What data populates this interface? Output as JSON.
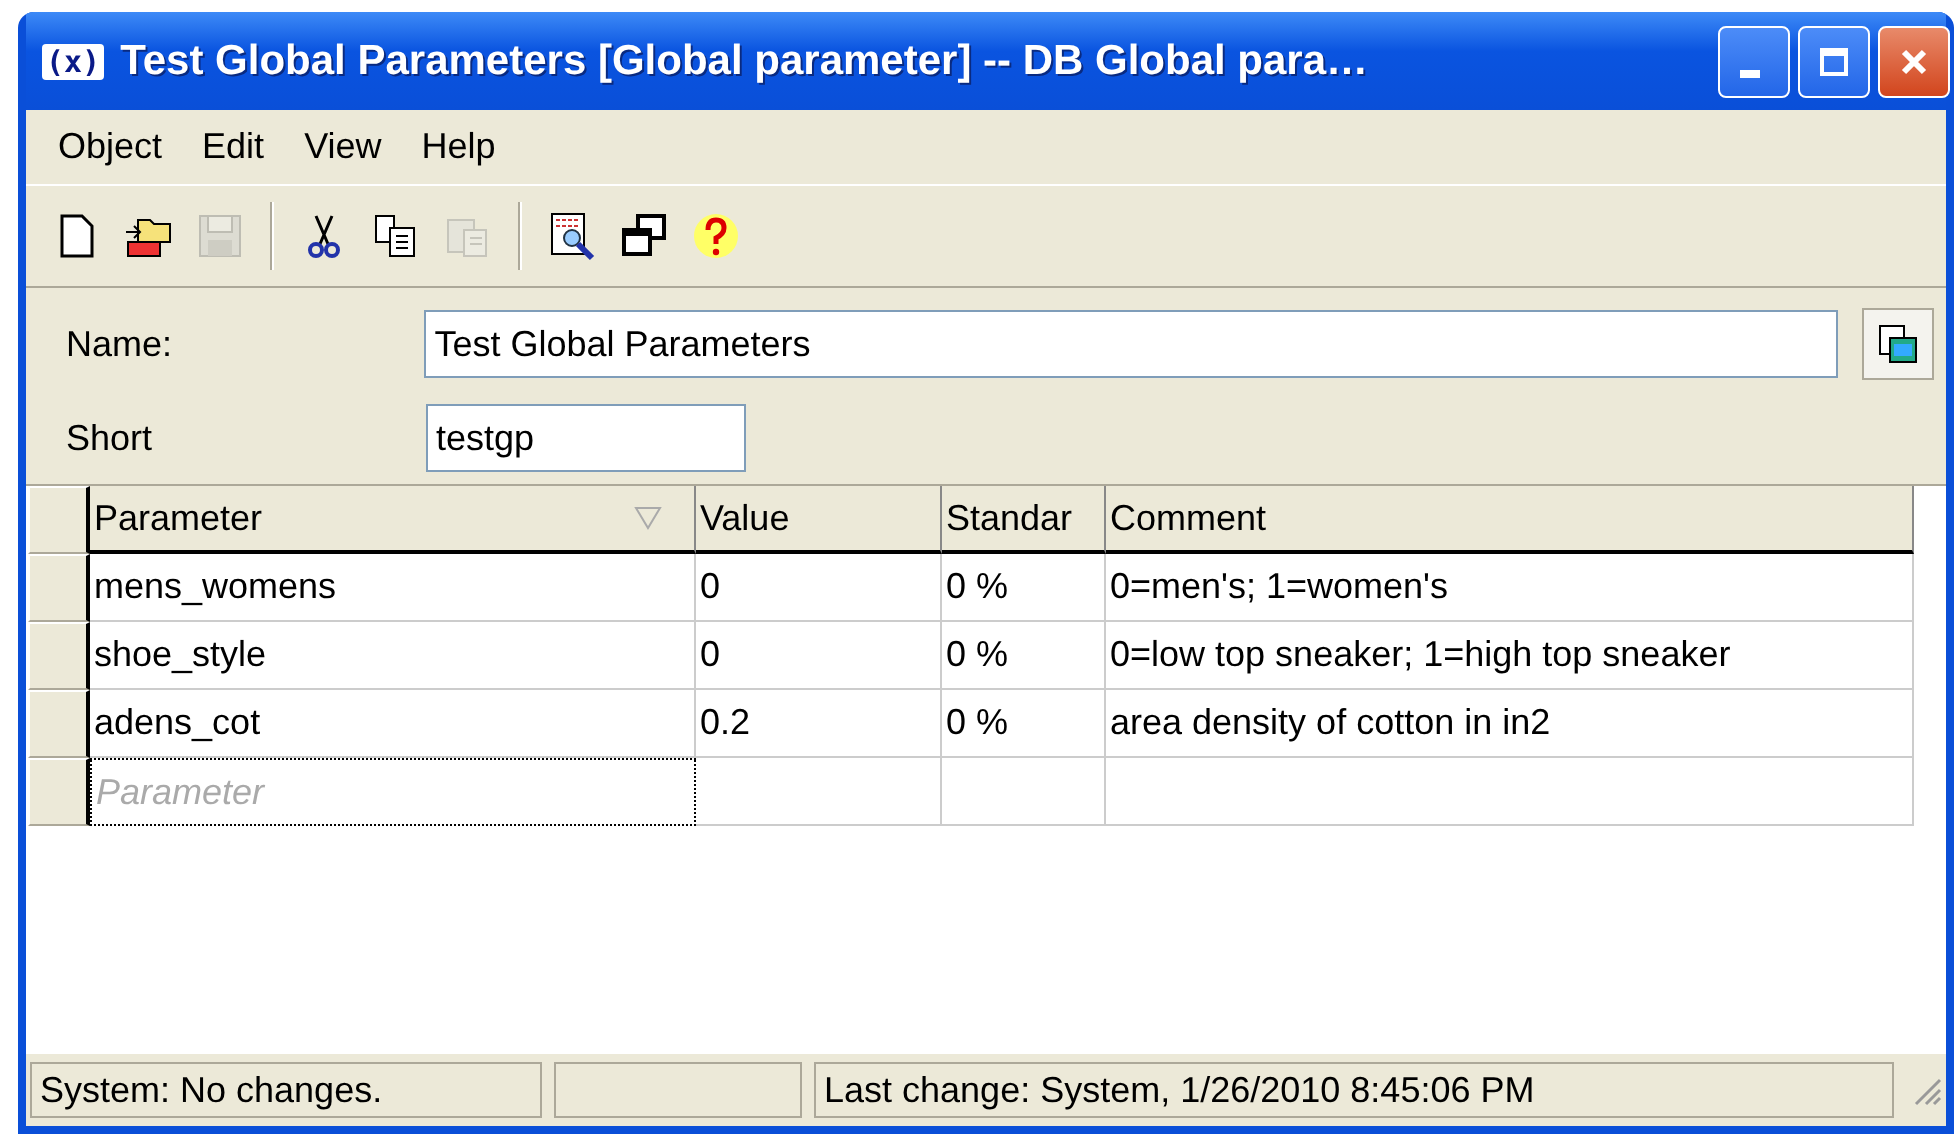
{
  "window": {
    "icon": "(x)",
    "title": "Test Global Parameters [Global parameter] -- DB Global para…"
  },
  "menu": [
    "Object",
    "Edit",
    "View",
    "Help"
  ],
  "toolbar": [
    [
      {
        "kind": "new",
        "disabled": false
      },
      {
        "kind": "open",
        "disabled": false
      },
      {
        "kind": "save",
        "disabled": true
      }
    ],
    [
      {
        "kind": "cut",
        "disabled": false
      },
      {
        "kind": "copy",
        "disabled": false
      },
      {
        "kind": "paste",
        "disabled": true
      }
    ],
    [
      {
        "kind": "preview",
        "disabled": false
      },
      {
        "kind": "windows",
        "disabled": false
      },
      {
        "kind": "help",
        "disabled": false
      }
    ]
  ],
  "form": {
    "name_label": "Name:",
    "name_value": "Test Global Parameters",
    "short_label": "Short",
    "short_value": "testgp"
  },
  "table": {
    "columns": [
      "Parameter",
      "Value",
      "Standar",
      "Comment"
    ],
    "rows": [
      [
        "mens_womens",
        "0",
        "0 %",
        "0=men's; 1=women's"
      ],
      [
        "shoe_style",
        "0",
        "0 %",
        "0=low top sneaker; 1=high top sneaker"
      ],
      [
        "adens_cot",
        "0.2",
        "0 %",
        "area density of cotton in in2"
      ]
    ],
    "new_row_placeholder": "Parameter"
  },
  "status_bar": [
    "System: No changes.",
    "Last change: System, 1/26/2010 8:45:06 PM"
  ]
}
